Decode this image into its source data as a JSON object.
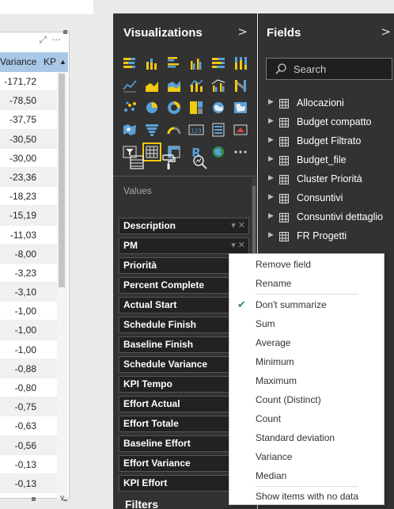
{
  "table": {
    "col_variance": "Variance",
    "col_kpi": "KP",
    "values": [
      "-171,72",
      "-78,50",
      "-37,75",
      "-30,50",
      "-30,00",
      "-23,36",
      "-18,23",
      "-15,19",
      "-11,03",
      "-8,00",
      "-3,23",
      "-3,10",
      "-1,00",
      "-1,00",
      "-1,00",
      "-0,88",
      "-0,80",
      "-0,75",
      "-0,63",
      "-0,56",
      "-0,13",
      "-0,13",
      "",
      ""
    ]
  },
  "visualizations": {
    "title": "Visualizations",
    "values_label": "Values",
    "filters_title": "Filters",
    "wells": [
      "Description",
      "PM",
      "Priorità",
      "Percent Complete",
      "Actual Start",
      "Schedule Finish",
      "Baseline Finish",
      "Schedule Variance",
      "KPI Tempo",
      "Effort Actual",
      "Effort Totale",
      "Baseline Effort",
      "Effort Variance",
      "KPI Effort"
    ]
  },
  "fields": {
    "title": "Fields",
    "search_placeholder": "Search",
    "tables": [
      "Allocazioni",
      "Budget compatto",
      "Budget Filtrato",
      "Budget_file",
      "Cluster Priorità",
      "Consuntivi",
      "Consuntivi dettaglio",
      "FR Progetti"
    ]
  },
  "context_menu": {
    "remove_field": "Remove field",
    "rename": "Rename",
    "dont_summarize": "Don't summarize",
    "sum": "Sum",
    "average": "Average",
    "minimum": "Minimum",
    "maximum": "Maximum",
    "count_distinct": "Count (Distinct)",
    "count": "Count",
    "std_dev": "Standard deviation",
    "variance": "Variance",
    "median": "Median",
    "show_no_data": "Show items with no data"
  },
  "colors": {
    "accent": "#f2c811",
    "pane_bg": "#323232",
    "header_blue": "#a9c8e8",
    "check_green": "#3a8d4a"
  }
}
